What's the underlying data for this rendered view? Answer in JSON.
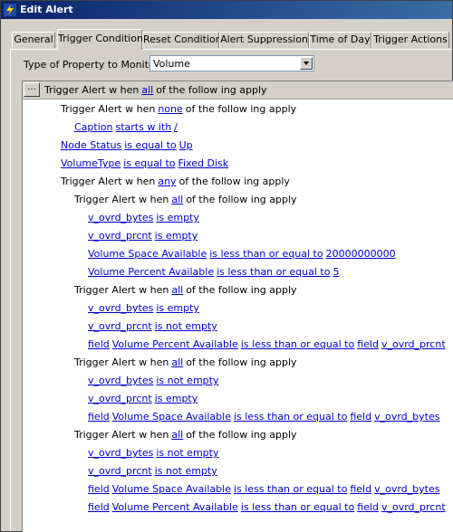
{
  "window": {
    "title": "Edit Alert"
  },
  "tabs": [
    "General",
    "Trigger Condition",
    "Reset Condition",
    "Alert Suppression",
    "Time of Day",
    "Trigger Actions"
  ],
  "monitor": {
    "label": "Type of Property to Monitor:",
    "value": "Volume"
  },
  "tree": {
    "expand_button": "...",
    "root": {
      "pre": "Trigger Alert w hen",
      "op": "all",
      "post": "of the follow ing apply"
    },
    "rows": [
      {
        "parts": [
          {
            "t": "Trigger Alert w hen",
            "link": false
          },
          {
            "t": "none",
            "link": true
          },
          {
            "t": "of the follow ing apply",
            "link": false
          }
        ]
      },
      {
        "parts": [
          {
            "t": "Caption",
            "link": true
          },
          {
            "t": "starts w ith",
            "link": true
          },
          {
            "t": "/",
            "link": true
          }
        ]
      },
      {
        "parts": [
          {
            "t": "Node Status",
            "link": true
          },
          {
            "t": "is equal to",
            "link": true
          },
          {
            "t": "Up",
            "link": true
          }
        ]
      },
      {
        "parts": [
          {
            "t": "VolumeType",
            "link": true
          },
          {
            "t": "is equal to",
            "link": true
          },
          {
            "t": "Fixed Disk",
            "link": true
          }
        ]
      },
      {
        "parts": [
          {
            "t": "Trigger Alert w hen",
            "link": false
          },
          {
            "t": "any",
            "link": true
          },
          {
            "t": "of the follow ing apply",
            "link": false
          }
        ]
      },
      {
        "parts": [
          {
            "t": "Trigger Alert w hen",
            "link": false
          },
          {
            "t": "all",
            "link": true
          },
          {
            "t": "of the follow ing apply",
            "link": false
          }
        ]
      },
      {
        "parts": [
          {
            "t": "v_ovrd_bytes",
            "link": true
          },
          {
            "t": "is empty",
            "link": true
          }
        ]
      },
      {
        "parts": [
          {
            "t": "v_ovrd_prcnt",
            "link": true
          },
          {
            "t": "is empty",
            "link": true
          }
        ]
      },
      {
        "parts": [
          {
            "t": "Volume Space Available",
            "link": true
          },
          {
            "t": "is less than or equal to",
            "link": true
          },
          {
            "t": "20000000000",
            "link": true
          }
        ]
      },
      {
        "parts": [
          {
            "t": "Volume Percent Available",
            "link": true
          },
          {
            "t": "is less than or equal to",
            "link": true
          },
          {
            "t": "5",
            "link": true
          }
        ]
      },
      {
        "parts": [
          {
            "t": "Trigger Alert w hen",
            "link": false
          },
          {
            "t": "all",
            "link": true
          },
          {
            "t": "of the follow ing apply",
            "link": false
          }
        ]
      },
      {
        "parts": [
          {
            "t": "v_ovrd_bytes",
            "link": true
          },
          {
            "t": "is empty",
            "link": true
          }
        ]
      },
      {
        "parts": [
          {
            "t": "v_ovrd_prcnt",
            "link": true
          },
          {
            "t": "is not empty",
            "link": true
          }
        ]
      },
      {
        "parts": [
          {
            "t": "field",
            "link": true
          },
          {
            "t": "Volume Percent Available",
            "link": true
          },
          {
            "t": "is less than or equal to",
            "link": true
          },
          {
            "t": "field",
            "link": true
          },
          {
            "t": "v_ovrd_prcnt",
            "link": true
          }
        ]
      },
      {
        "parts": [
          {
            "t": "Trigger Alert w hen",
            "link": false
          },
          {
            "t": "all",
            "link": true
          },
          {
            "t": "of the follow ing apply",
            "link": false
          }
        ]
      },
      {
        "parts": [
          {
            "t": "v_ovrd_bytes",
            "link": true
          },
          {
            "t": "is not empty",
            "link": true
          }
        ]
      },
      {
        "parts": [
          {
            "t": "v_ovrd_prcnt",
            "link": true
          },
          {
            "t": "is empty",
            "link": true
          }
        ]
      },
      {
        "parts": [
          {
            "t": "field",
            "link": true
          },
          {
            "t": "Volume Space Available",
            "link": true
          },
          {
            "t": "is less than or equal to",
            "link": true
          },
          {
            "t": "field",
            "link": true
          },
          {
            "t": "v_ovrd_bytes",
            "link": true
          }
        ]
      },
      {
        "parts": [
          {
            "t": "Trigger Alert w hen",
            "link": false
          },
          {
            "t": "all",
            "link": true
          },
          {
            "t": "of the follow ing apply",
            "link": false
          }
        ]
      },
      {
        "parts": [
          {
            "t": "v_ovrd_bytes",
            "link": true
          },
          {
            "t": "is not empty",
            "link": true
          }
        ]
      },
      {
        "parts": [
          {
            "t": "v_ovrd_prcnt",
            "link": true
          },
          {
            "t": "is not empty",
            "link": true
          }
        ]
      },
      {
        "parts": [
          {
            "t": "field",
            "link": true
          },
          {
            "t": "Volume Space Available",
            "link": true
          },
          {
            "t": "is less than or equal to",
            "link": true
          },
          {
            "t": "field",
            "link": true
          },
          {
            "t": "v_ovrd_bytes",
            "link": true
          }
        ]
      },
      {
        "parts": [
          {
            "t": "field",
            "link": true
          },
          {
            "t": "Volume Percent Available",
            "link": true
          },
          {
            "t": "is less than or equal to",
            "link": true
          },
          {
            "t": "field",
            "link": true
          },
          {
            "t": "v_ovrd_prcnt",
            "link": true
          }
        ]
      }
    ]
  }
}
